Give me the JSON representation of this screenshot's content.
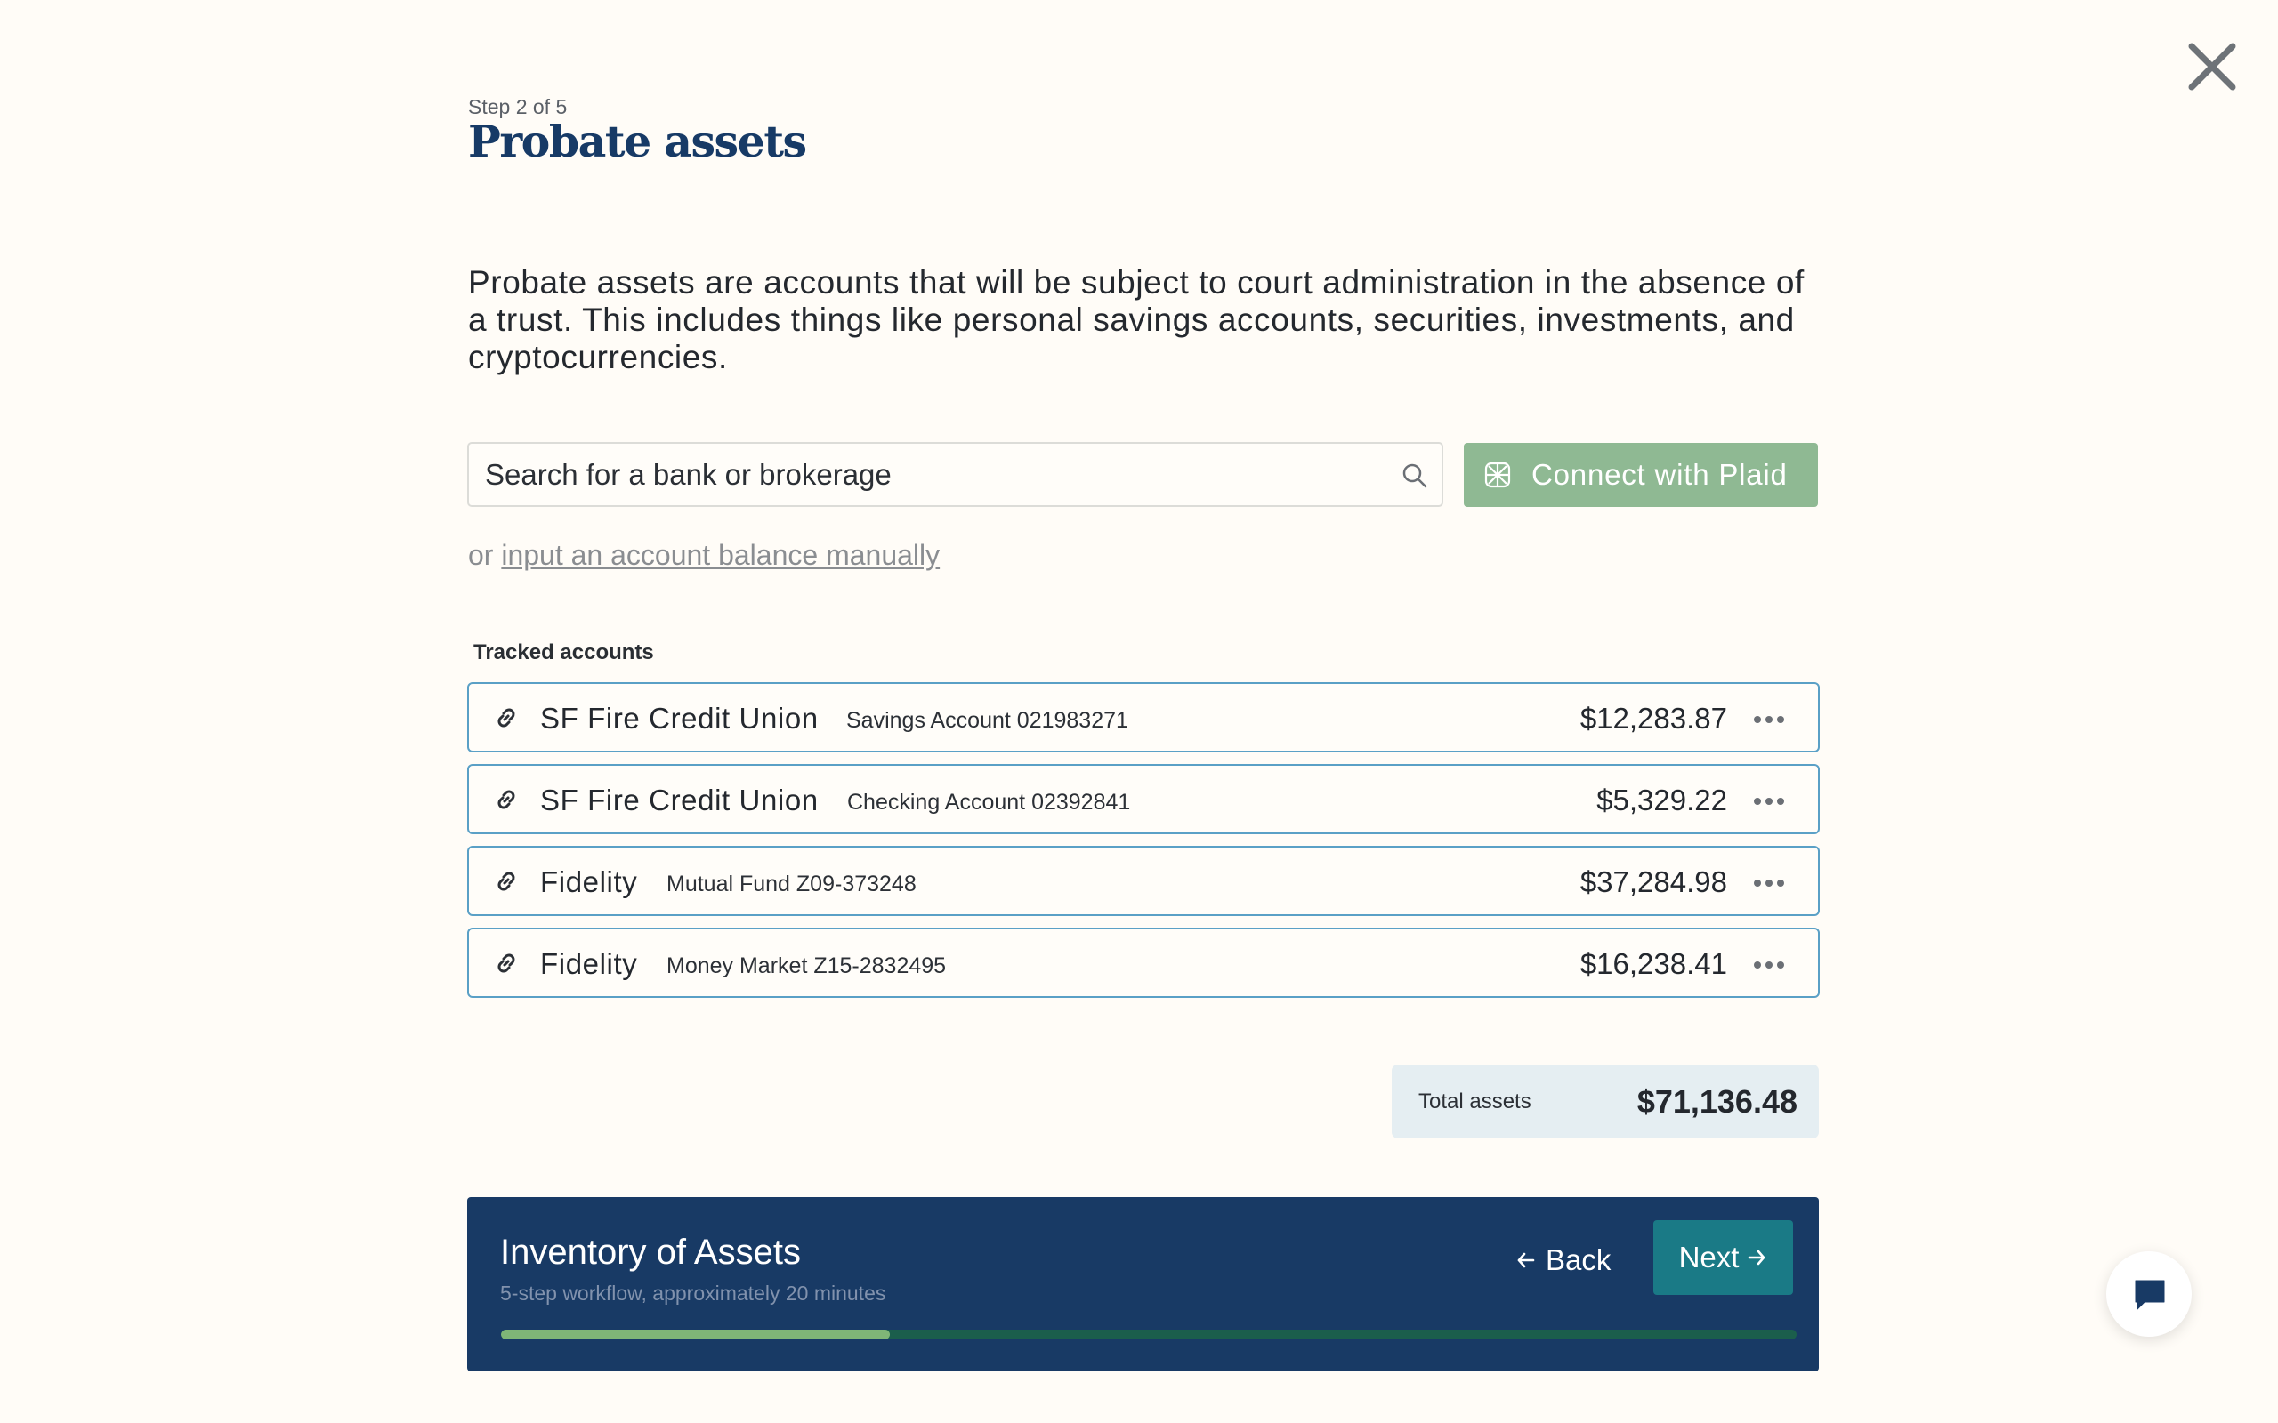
{
  "header": {
    "step": "Step 2 of 5",
    "title": "Probate assets"
  },
  "intro": "Probate assets are accounts that will be subject to court administration in the absence of a trust. This includes things like personal savings accounts, securities, investments, and cryptocurrencies.",
  "search": {
    "placeholder": "Search for a bank or brokerage",
    "value": ""
  },
  "plaid_button": {
    "label": "Connect with Plaid",
    "color": "#8fb993"
  },
  "manual": {
    "prefix": "or",
    "link_label": "input an account balance manually"
  },
  "tracked": {
    "heading": "Tracked accounts",
    "accounts": [
      {
        "name": "SF Fire Credit Union",
        "desc": "Savings Account 021983271",
        "amount": "$12,283.87"
      },
      {
        "name": "SF Fire Credit Union",
        "desc": "Checking Account 02392841",
        "amount": "$5,329.22"
      },
      {
        "name": "Fidelity",
        "desc": "Mutual Fund Z09-373248",
        "amount": "$37,284.98"
      },
      {
        "name": "Fidelity",
        "desc": "Money Market Z15-2832495",
        "amount": "$16,238.41"
      }
    ]
  },
  "total": {
    "label": "Total assets",
    "value": "$71,136.48"
  },
  "workflow": {
    "title": "Inventory of Assets",
    "subtitle": "5-step workflow, approximately 20 minutes",
    "back_label": "Back",
    "next_label": "Next",
    "progress_fraction": 0.3
  },
  "icons": {
    "close": "close-icon",
    "search": "search-icon",
    "plaid": "plaid-logo-icon",
    "account_link": "link-icon",
    "more": "more-options-icon",
    "back": "arrow-left-icon",
    "next": "arrow-right-icon",
    "chat": "chat-bubble-icon"
  },
  "colors": {
    "background": "#fffcf7",
    "title": "#173a66",
    "account_border": "#5aa0c6",
    "workflow_bg": "#183a65",
    "next_button": "#1a7a86",
    "progress_fill": "#7fb577",
    "progress_track": "#1b5e4c",
    "total_bg": "#e5eef2"
  }
}
